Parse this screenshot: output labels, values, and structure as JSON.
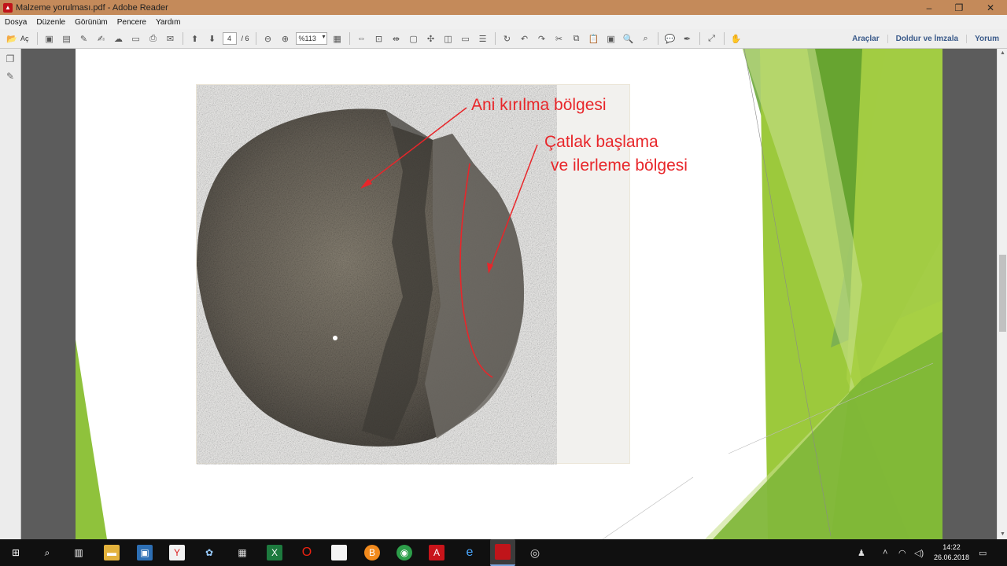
{
  "window": {
    "title": "Malzeme yorulması.pdf - Adobe Reader",
    "minimize": "–",
    "restore": "❐",
    "close": "✕"
  },
  "menu": [
    "Dosya",
    "Düzenle",
    "Görünüm",
    "Pencere",
    "Yardım"
  ],
  "toolbar": {
    "open_label": "Aç",
    "page_current": "4",
    "page_total": "/ 6",
    "zoom": "%113",
    "right_links": [
      "Araçlar",
      "Doldur ve İmzala",
      "Yorum"
    ]
  },
  "slide": {
    "label_top": "Ani kırılma bölgesi",
    "label_crack_1": "Çatlak başlama",
    "label_crack_2": "ve ilerleme bölgesi",
    "annotation_color": "#e8262a",
    "accent_greens": [
      "#7ab648",
      "#9cc93c",
      "#5e9e2e",
      "#c6e08a"
    ]
  },
  "taskbar": {
    "time": "14:22",
    "date": "26.06.2018"
  }
}
